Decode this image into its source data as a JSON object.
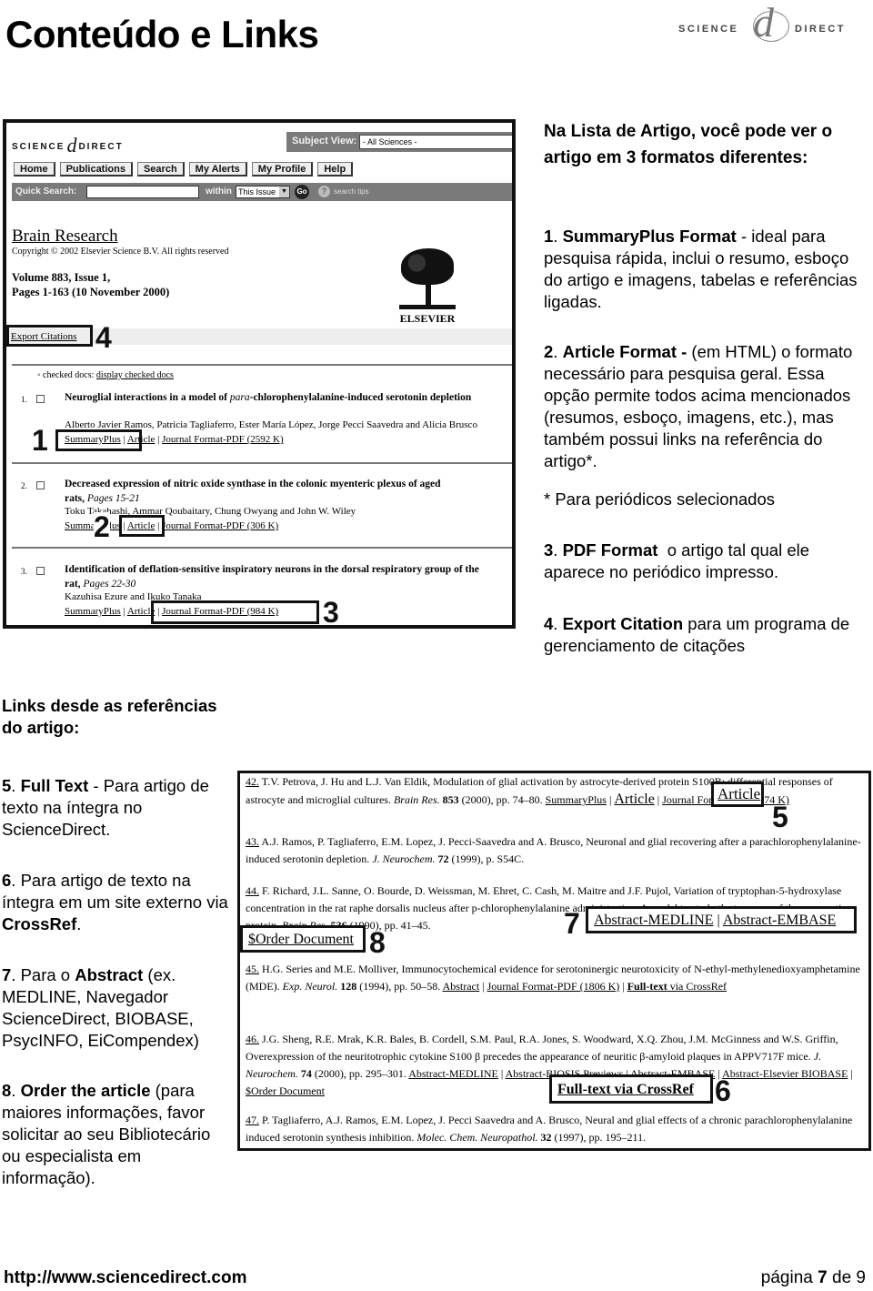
{
  "page": {
    "title": "Conteúdo e Links",
    "logo": {
      "left": "SCIENCE",
      "mark": "d",
      "right": "DIRECT"
    }
  },
  "screenshot1": {
    "logo": {
      "left": "SCIENCE",
      "mark": "d",
      "right": "DIRECT"
    },
    "subject_view": {
      "label": "Subject View:",
      "value": "- All Sciences -"
    },
    "nav": [
      "Home",
      "Publications",
      "Search",
      "My Alerts",
      "My Profile",
      "Help"
    ],
    "quick_search": {
      "label": "Quick Search:",
      "value": "",
      "within_label": "within",
      "within_value": "This Issue",
      "go_label": "Go",
      "tips_label": "search tips"
    },
    "journal": {
      "title": "Brain Research",
      "copyright": "Copyright © 2002 Elsevier Science B.V. All rights reserved",
      "volume": "Volume 883, Issue 1,",
      "pages": "Pages 1-163 (10 November 2000)",
      "publisher": "ELSEVIER"
    },
    "export_citations": "Export Citations",
    "checked_docs": {
      "radio": "ʻ",
      "label": "checked docs:",
      "link": "display checked docs"
    },
    "articles": [
      {
        "num": "1.",
        "title_pre": "Neuroglial interactions in a model of ",
        "title_italic": "para",
        "title_post": "-chlorophenylalanine-induced serotonin depletion",
        "pages": "",
        "authors": "Alberto Javier Ramos, Patricia Tagliaferro, Ester María López, Jorge Pecci Saavedra and Alicia Brusco",
        "links": [
          "SummaryPlus",
          "Article",
          "Journal Format-PDF (2592 K)"
        ]
      },
      {
        "num": "2.",
        "title_pre": "Decreased expression of nitric oxide synthase in the colonic myenteric plexus of aged",
        "title_line2": "rats,",
        "pages": "Pages 15-21",
        "authors": "Toku Takahashi, Ammar Qoubaitary, Chung Owyang and John W. Wiley",
        "links": [
          "SummaryPlus",
          "Article",
          "Journal Format-PDF (306 K)"
        ]
      },
      {
        "num": "3.",
        "title_pre": "Identification of deflation-sensitive inspiratory neurons in the dorsal respiratory group of the",
        "title_line2": "rat,",
        "pages": "Pages 22-30",
        "authors": "Kazuhisa Ezure and Ikuko Tanaka",
        "links": [
          "SummaryPlus",
          "Article",
          "Journal Format-PDF (984 K)"
        ]
      }
    ],
    "callouts": [
      "1",
      "2",
      "3",
      "4"
    ]
  },
  "formats_text": {
    "heading": "Na Lista de Artigo, você pode ver o artigo em 3 formatos diferentes:",
    "items": [
      {
        "num": "1",
        "bold": "SummaryPlus Format",
        "text": " - ideal para pesquisa rápida, inclui o resumo, esboço do artigo e imagens, tabelas e referências ligadas."
      },
      {
        "num": "2",
        "bold": "Article Format -",
        "text": " (em HTML) o formato necessário para pesquisa geral. Essa opção permite todos acima mencionados (resumos, esboço, imagens, etc.), mas também possui links na referência do artigo*."
      },
      {
        "note": "* Para periódicos selecionados"
      },
      {
        "num": "3",
        "bold": "PDF Format",
        "text": "  o artigo tal qual ele aparece no periódico impresso."
      },
      {
        "num": "4",
        "bold": "Export Citation",
        "text": " para um programa de gerenciamento de citações"
      }
    ]
  },
  "links_text": {
    "heading": "Links desde as referências do artigo:",
    "items": [
      {
        "num": "5",
        "bold": "Full Text",
        "text": " - Para artigo de texto na íntegra no ScienceDirect."
      },
      {
        "num": "6",
        "text": "Para artigo de texto na íntegra em um site externo via ",
        "bold_end": "CrossRef",
        "end": "."
      },
      {
        "num": "7",
        "text": "Para o ",
        "bold_mid": "Abstract",
        "rest": " (ex. MEDLINE, Navegador ScienceDirect, BIOBASE, PsycINFO, EiCompendex)"
      },
      {
        "num": "8",
        "bold": "Order the article",
        "text": " (para maiores informações, favor solicitar ao seu Bibliotecário ou especialista em informação)."
      }
    ]
  },
  "screenshot2": {
    "refs": [
      {
        "num": "42.",
        "text": " T.V. Petrova, J. Hu and L.J. Van Eldik, Modulation of glial activation by astrocyte-derived protein S100B: differential responses of astrocyte and microglial cultures. ",
        "journal": "Brain Res.",
        "vol": " 853",
        "rest": " (2000), pp. 74–80. ",
        "links": [
          "SummaryPlus",
          "Article",
          "Journal Format-PDF (174 K)"
        ]
      },
      {
        "num": "43.",
        "text": " A.J. Ramos, P. Tagliaferro, E.M. Lopez, J. Pecci-Saavedra and A. Brusco, Neuronal and glial recovering after a parachlorophenylalanine-induced serotonin depletion. ",
        "journal": "J. Neurochem.",
        "vol": " 72",
        "rest": " (1999), p. S54C."
      },
      {
        "num": "44.",
        "text": " F. Richard, J.L. Sanne, O. Bourde, D. Weissman, M. Ehret, C. Cash, M. Maitre and J.F. Pujol, Variation of tryptophan-5-hydroxylase concentration in the rat raphe dorsalis nucleus after p-chlorophenylalanine administration. A model to study the turnover of the enzymatic protein. ",
        "journal": "Brain Res.",
        "vol": " 536",
        "rest": " (1990), pp. 41–45. ",
        "links": [
          "Abstract-MEDLINE",
          "Abstract-EMBASE",
          "$Order Document"
        ]
      },
      {
        "num": "45.",
        "text": " H.G. Series and M.E. Molliver, Immunocytochemical evidence for serotoninergic neurotoxicity of N-ethyl-methylenedioxyamphetamine (MDE). ",
        "journal": "Exp. Neurol.",
        "vol": " 128",
        "rest": " (1994), pp. 50–58. ",
        "links": [
          "Abstract",
          "Journal Format-PDF (1806 K)",
          "Full-text",
          " via CrossRef"
        ]
      },
      {
        "num": "46.",
        "text": " J.G. Sheng, R.E. Mrak, K.R. Bales, B. Cordell, S.M. Paul, R.A. Jones, S. Woodward, X.Q. Zhou, J.M. McGinness and W.S. Griffin, Overexpression of the neuritotrophic cytokine S100 β precedes the appearance of neuritic β-amyloid plaques in APPV717F mice. ",
        "journal": "J. Neurochem.",
        "vol": " 74",
        "rest": " (2000), pp. 295–301. ",
        "links": [
          "Abstract-MEDLINE",
          "Abstract-BIOSIS Previews",
          "Abstract-EMBASE",
          "Abstract-Elsevier BIOBASE",
          "$Order Document",
          "Full-text via CrossRef"
        ]
      },
      {
        "num": "47.",
        "text": " P. Tagliaferro, A.J. Ramos, E.M. Lopez, J. Pecci Saavedra and A. Brusco, Neural and glial effects of a chronic parachlorophenylalanine induced serotonin synthesis inhibition. ",
        "journal": "Molec. Chem. Neuropathol.",
        "vol": " 32",
        "rest": " (1997), pp. 195–211."
      }
    ],
    "callouts": [
      "5",
      "6",
      "7",
      "8"
    ]
  },
  "footer": {
    "url": "http://www.sciencedirect.com",
    "page_prefix": "página ",
    "page_num": "7",
    "page_mid": " de ",
    "page_total": "9"
  }
}
